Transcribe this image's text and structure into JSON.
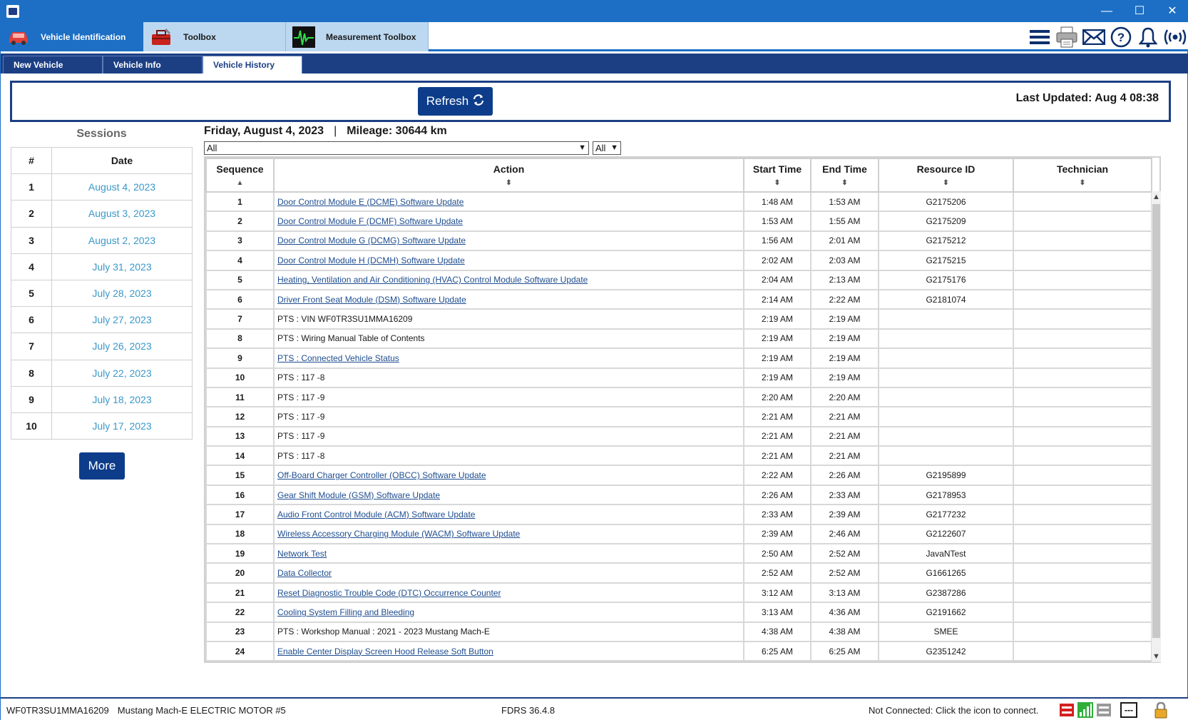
{
  "window": {
    "min": "—",
    "max": "☐",
    "close": "✕"
  },
  "modules": [
    {
      "label": "Vehicle Identification",
      "icon": "car-icon"
    },
    {
      "label": "Toolbox",
      "icon": "toolbox-icon"
    },
    {
      "label": "Measurement Toolbox",
      "icon": "oscilloscope-icon"
    }
  ],
  "toolbar_icons": [
    "menu-icon",
    "printer-icon",
    "mail-icon",
    "help-icon",
    "bell-icon",
    "wireless-icon"
  ],
  "subtabs": [
    "New Vehicle",
    "Vehicle Info",
    "Vehicle History"
  ],
  "refresh": {
    "label": "Refresh",
    "last_updated": "Last Updated: Aug 4 08:38"
  },
  "sessions": {
    "title": "Sessions",
    "col_num": "#",
    "col_date": "Date",
    "rows": [
      {
        "n": "1",
        "date": "August 4, 2023"
      },
      {
        "n": "2",
        "date": "August 3, 2023"
      },
      {
        "n": "3",
        "date": "August 2, 2023"
      },
      {
        "n": "4",
        "date": "July 31, 2023"
      },
      {
        "n": "5",
        "date": "July 28, 2023"
      },
      {
        "n": "6",
        "date": "July 27, 2023"
      },
      {
        "n": "7",
        "date": "July 26, 2023"
      },
      {
        "n": "8",
        "date": "July 22, 2023"
      },
      {
        "n": "9",
        "date": "July 18, 2023"
      },
      {
        "n": "10",
        "date": "July 17, 2023"
      }
    ],
    "more_label": "More"
  },
  "day": {
    "date": "Friday, August 4, 2023",
    "separator": "|",
    "mileage": "Mileage: 30644 km"
  },
  "filters": {
    "action": "All",
    "resource": "All"
  },
  "history": {
    "columns": [
      "Sequence",
      "Action",
      "Start Time",
      "End Time",
      "Resource ID",
      "Technician"
    ],
    "rows": [
      {
        "seq": "1",
        "action": "Door Control Module E (DCME) Software Update",
        "link": true,
        "start": "1:48 AM",
        "end": "1:53 AM",
        "rid": "G2175206",
        "tech": ""
      },
      {
        "seq": "2",
        "action": "Door Control Module F (DCMF) Software Update",
        "link": true,
        "start": "1:53 AM",
        "end": "1:55 AM",
        "rid": "G2175209",
        "tech": ""
      },
      {
        "seq": "3",
        "action": "Door Control Module G (DCMG) Software Update",
        "link": true,
        "start": "1:56 AM",
        "end": "2:01 AM",
        "rid": "G2175212",
        "tech": ""
      },
      {
        "seq": "4",
        "action": "Door Control Module H (DCMH) Software Update",
        "link": true,
        "start": "2:02 AM",
        "end": "2:03 AM",
        "rid": "G2175215",
        "tech": ""
      },
      {
        "seq": "5",
        "action": "Heating, Ventilation and Air Conditioning (HVAC) Control Module Software Update",
        "link": true,
        "start": "2:04 AM",
        "end": "2:13 AM",
        "rid": "G2175176",
        "tech": ""
      },
      {
        "seq": "6",
        "action": "Driver Front Seat Module (DSM) Software Update",
        "link": true,
        "start": "2:14 AM",
        "end": "2:22 AM",
        "rid": "G2181074",
        "tech": ""
      },
      {
        "seq": "7",
        "action": "PTS : VIN WF0TR3SU1MMA16209",
        "link": false,
        "start": "2:19 AM",
        "end": "2:19 AM",
        "rid": "",
        "tech": ""
      },
      {
        "seq": "8",
        "action": "PTS : Wiring Manual Table of Contents",
        "link": false,
        "start": "2:19 AM",
        "end": "2:19 AM",
        "rid": "",
        "tech": ""
      },
      {
        "seq": "9",
        "action": "PTS : Connected Vehicle Status",
        "link": true,
        "start": "2:19 AM",
        "end": "2:19 AM",
        "rid": "",
        "tech": ""
      },
      {
        "seq": "10",
        "action": "PTS : 117 -8",
        "link": false,
        "start": "2:19 AM",
        "end": "2:19 AM",
        "rid": "",
        "tech": ""
      },
      {
        "seq": "11",
        "action": "PTS : 117 -9",
        "link": false,
        "start": "2:20 AM",
        "end": "2:20 AM",
        "rid": "",
        "tech": ""
      },
      {
        "seq": "12",
        "action": "PTS : 117 -9",
        "link": false,
        "start": "2:21 AM",
        "end": "2:21 AM",
        "rid": "",
        "tech": ""
      },
      {
        "seq": "13",
        "action": "PTS : 117 -9",
        "link": false,
        "start": "2:21 AM",
        "end": "2:21 AM",
        "rid": "",
        "tech": ""
      },
      {
        "seq": "14",
        "action": "PTS : 117 -8",
        "link": false,
        "start": "2:21 AM",
        "end": "2:21 AM",
        "rid": "",
        "tech": ""
      },
      {
        "seq": "15",
        "action": "Off-Board Charger Controller (OBCC) Software Update",
        "link": true,
        "start": "2:22 AM",
        "end": "2:26 AM",
        "rid": "G2195899",
        "tech": ""
      },
      {
        "seq": "16",
        "action": "Gear Shift Module (GSM) Software Update",
        "link": true,
        "start": "2:26 AM",
        "end": "2:33 AM",
        "rid": "G2178953",
        "tech": ""
      },
      {
        "seq": "17",
        "action": "Audio Front Control Module (ACM) Software Update",
        "link": true,
        "start": "2:33 AM",
        "end": "2:39 AM",
        "rid": "G2177232",
        "tech": ""
      },
      {
        "seq": "18",
        "action": "Wireless Accessory Charging Module (WACM) Software Update",
        "link": true,
        "start": "2:39 AM",
        "end": "2:46 AM",
        "rid": "G2122607",
        "tech": ""
      },
      {
        "seq": "19",
        "action": "Network Test",
        "link": true,
        "start": "2:50 AM",
        "end": "2:52 AM",
        "rid": "JavaNTest",
        "tech": ""
      },
      {
        "seq": "20",
        "action": "Data Collector",
        "link": true,
        "start": "2:52 AM",
        "end": "2:52 AM",
        "rid": "G1661265",
        "tech": ""
      },
      {
        "seq": "21",
        "action": "Reset Diagnostic Trouble Code (DTC) Occurrence Counter",
        "link": true,
        "start": "3:12 AM",
        "end": "3:13 AM",
        "rid": "G2387286",
        "tech": ""
      },
      {
        "seq": "22",
        "action": "Cooling System Filling and Bleeding",
        "link": true,
        "start": "3:13 AM",
        "end": "4:36 AM",
        "rid": "G2191662",
        "tech": ""
      },
      {
        "seq": "23",
        "action": "PTS : Workshop Manual : 2021 - 2023 Mustang Mach-E",
        "link": false,
        "start": "4:38 AM",
        "end": "4:38 AM",
        "rid": "SMEE",
        "tech": ""
      },
      {
        "seq": "24",
        "action": "Enable Center Display Screen Hood Release Soft Button",
        "link": true,
        "start": "6:25 AM",
        "end": "6:25 AM",
        "rid": "G2351242",
        "tech": ""
      }
    ]
  },
  "status": {
    "vin": "WF0TR3SU1MMA16209",
    "model": "Mustang Mach-E ELECTRIC MOTOR #5",
    "version": "FDRS 36.4.8",
    "connection": "Not Connected: Click the icon to connect.",
    "box": "---"
  },
  "colors": {
    "brand_blue": "#1c6fc4",
    "navy": "#1c3f84",
    "button": "#0d3d8a",
    "link": "#1e4d8f",
    "date_link": "#3a98c9"
  }
}
